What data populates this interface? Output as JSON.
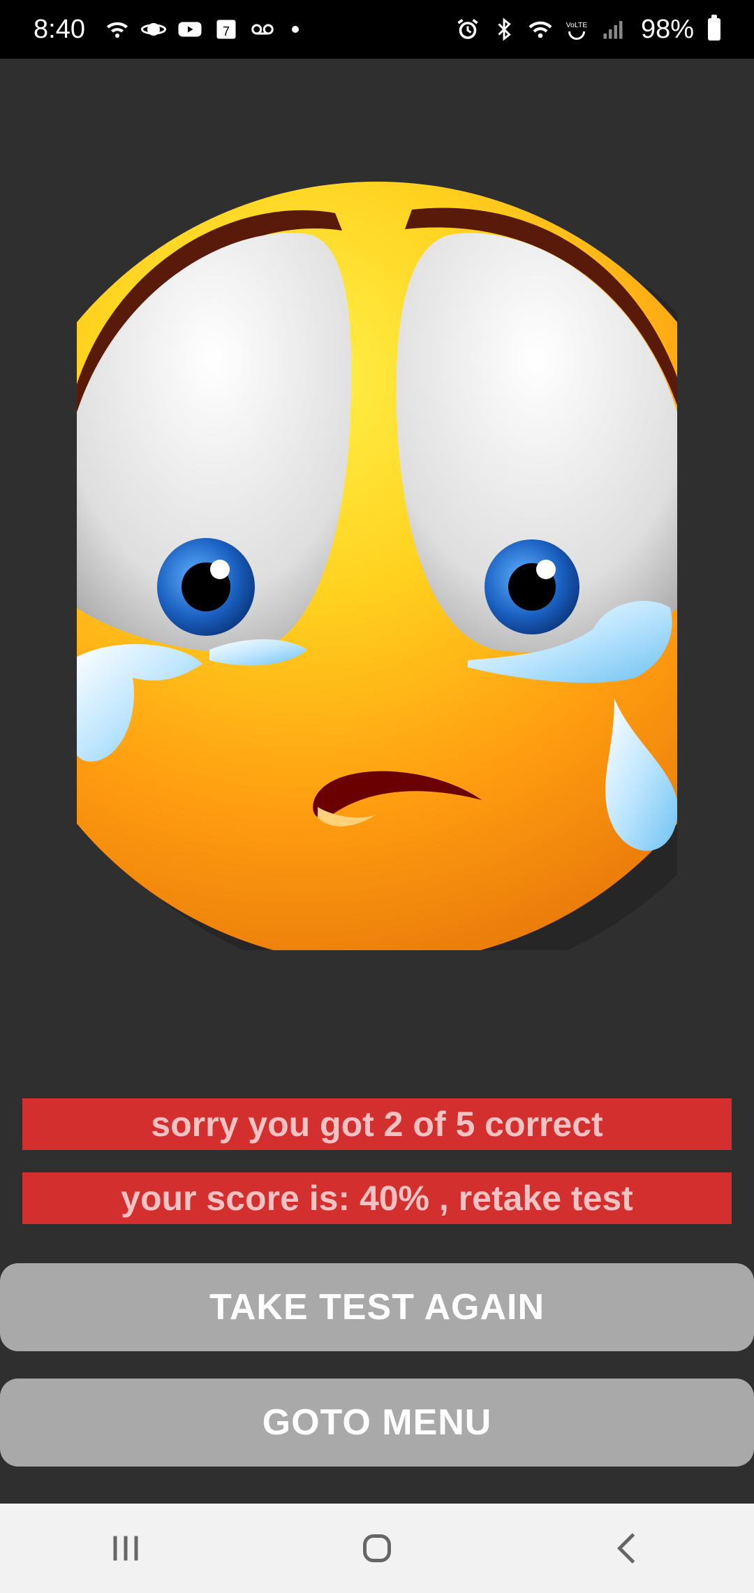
{
  "status_bar": {
    "time": "8:40",
    "battery": "98%",
    "left_icons": [
      "wifi-calling-icon",
      "saturn-icon",
      "youtube-icon",
      "calendar-icon",
      "voicemail-icon",
      "dot-icon"
    ],
    "right_icons": [
      "alarm-icon",
      "bluetooth-icon",
      "wifi-icon",
      "volte-icon",
      "signal-icon",
      "battery-icon"
    ]
  },
  "result": {
    "message": "sorry you got 2 of 5 correct",
    "score": "your score is: 40% , retake test"
  },
  "buttons": {
    "take_test_again": "TAKE TEST AGAIN",
    "goto_menu": "GOTO MENU"
  },
  "nav": {
    "icons": [
      "recent-apps-icon",
      "home-icon",
      "back-icon"
    ]
  },
  "colors": {
    "background": "#2f2f2f",
    "banner": "#d32f2f",
    "banner_text": "#f4c2c2",
    "button": "#a9a9a9",
    "button_text": "#ffffff"
  }
}
